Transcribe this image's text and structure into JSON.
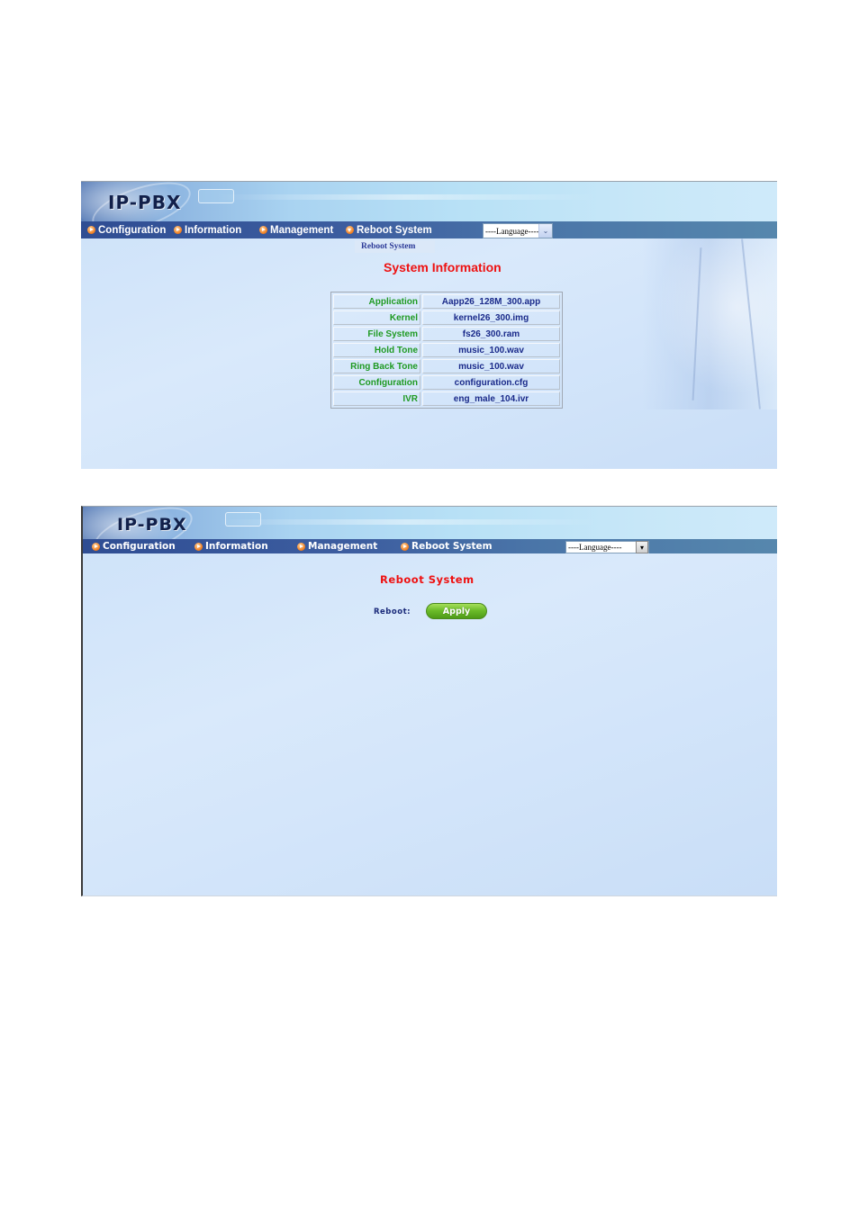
{
  "screens": [
    {
      "logo": "IP-PBX",
      "nav": [
        {
          "label": "Configuration",
          "icon": "arrow-right-bullet-icon"
        },
        {
          "label": "Information",
          "icon": "arrow-right-bullet-icon"
        },
        {
          "label": "Management",
          "icon": "arrow-right-bullet-icon"
        },
        {
          "label": "Reboot System",
          "icon": "arrow-down-bullet-icon"
        }
      ],
      "language_select": {
        "selected": "----Language----"
      },
      "submenu": {
        "items": [
          "Reboot System"
        ]
      },
      "title": "System Information",
      "info_table": [
        {
          "label": "Application",
          "value": "Aapp26_128M_300.app"
        },
        {
          "label": "Kernel",
          "value": "kernel26_300.img"
        },
        {
          "label": "File System",
          "value": "fs26_300.ram"
        },
        {
          "label": "Hold Tone",
          "value": "music_100.wav"
        },
        {
          "label": "Ring Back Tone",
          "value": "music_100.wav"
        },
        {
          "label": "Configuration",
          "value": "configuration.cfg"
        },
        {
          "label": "IVR",
          "value": "eng_male_104.ivr"
        }
      ]
    },
    {
      "logo": "IP-PBX",
      "nav": [
        {
          "label": "Configuration",
          "icon": "arrow-right-bullet-icon"
        },
        {
          "label": "Information",
          "icon": "arrow-right-bullet-icon"
        },
        {
          "label": "Management",
          "icon": "arrow-right-bullet-icon"
        },
        {
          "label": "Reboot System",
          "icon": "arrow-right-bullet-icon"
        }
      ],
      "language_select": {
        "selected": "----Language----"
      },
      "title": "Reboot System",
      "reboot": {
        "label": "Reboot:",
        "button": "Apply"
      }
    }
  ]
}
